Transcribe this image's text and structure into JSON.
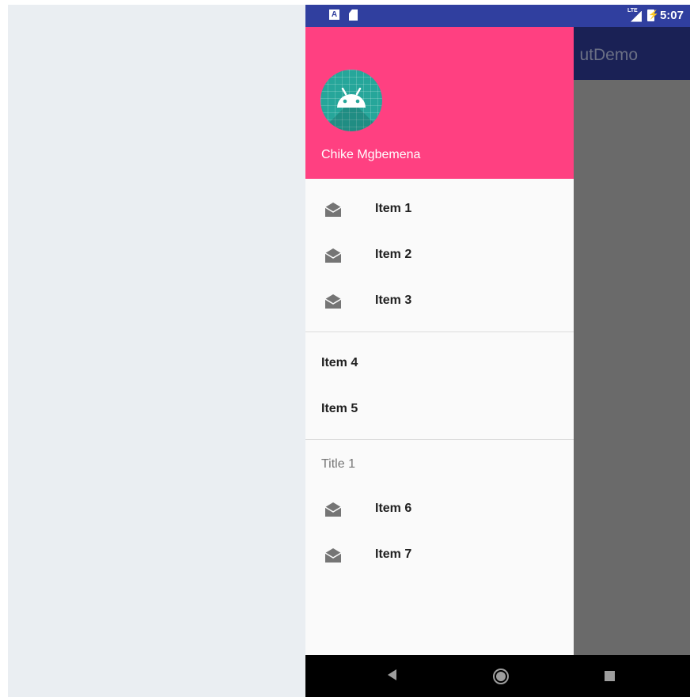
{
  "status_bar": {
    "sim_icon_letter": "A",
    "lte_label": "LTE",
    "time": "5:07",
    "icons": [
      "a-notification-icon",
      "sd-card-icon",
      "lte-signal-icon",
      "battery-charging-icon"
    ]
  },
  "app_bar": {
    "title_visible_fragment": "utDemo"
  },
  "drawer": {
    "header": {
      "user_name": "Chike Mgbemena",
      "avatar_icon": "android-robot-icon",
      "header_color": "#ff4081",
      "avatar_color": "#26a69a"
    },
    "group1": [
      {
        "label": "Item 1",
        "icon": "drafts-envelope-icon"
      },
      {
        "label": "Item 2",
        "icon": "drafts-envelope-icon"
      },
      {
        "label": "Item 3",
        "icon": "drafts-envelope-icon"
      }
    ],
    "group2": [
      {
        "label": "Item 4"
      },
      {
        "label": "Item 5"
      }
    ],
    "group3": {
      "title": "Title 1",
      "items": [
        {
          "label": "Item 6",
          "icon": "drafts-envelope-icon"
        },
        {
          "label": "Item 7",
          "icon": "drafts-envelope-icon"
        }
      ]
    }
  },
  "nav_bar": {
    "buttons": [
      "back-icon",
      "home-icon",
      "recents-icon"
    ]
  },
  "colors": {
    "status_bar": "#303f9f",
    "app_bar": "#1a2155",
    "scrim_area": "#6a6a6a",
    "backdrop": "#eaeef2"
  }
}
